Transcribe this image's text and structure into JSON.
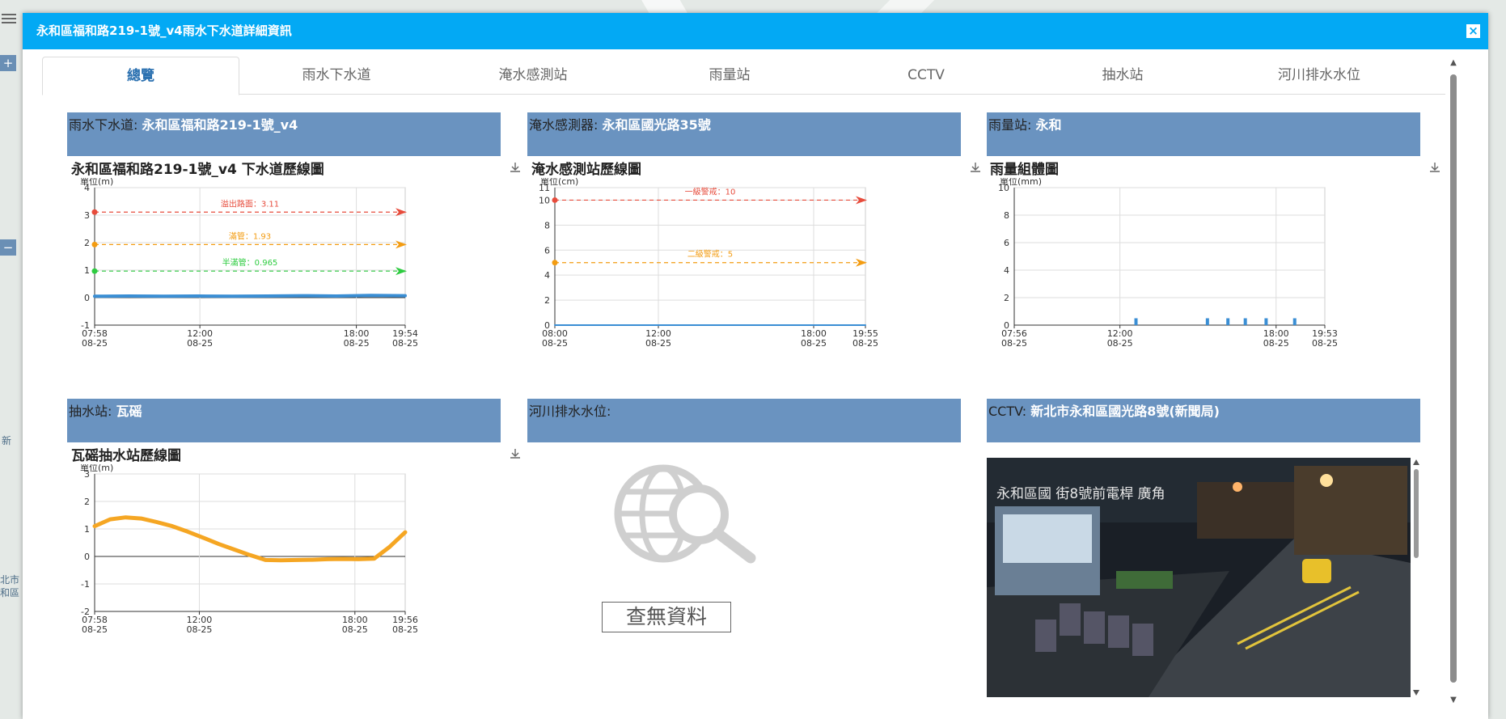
{
  "modal": {
    "title": "永和區福和路219-1號_v4雨水下水道詳細資訊",
    "close_icon": "close-icon"
  },
  "tabs": [
    "總覽",
    "雨水下水道",
    "淹水感測站",
    "雨量站",
    "CCTV",
    "抽水站",
    "河川排水水位"
  ],
  "active_tab": "總覽",
  "cards": {
    "sewer": {
      "label": "雨水下水道: ",
      "value": "永和區福和路219-1號_v4"
    },
    "flood": {
      "label": "淹水感測器: ",
      "value": "永和區國光路35號"
    },
    "rain": {
      "label": "雨量站: ",
      "value": "永和"
    },
    "pump": {
      "label": "抽水站: ",
      "value": "瓦磘"
    },
    "river": {
      "label": "河川排水水位:",
      "value": ""
    },
    "cctv": {
      "label": "CCTV: ",
      "value": "新北市永和區國光路8號(新聞局)"
    }
  },
  "river_nodata": "查無資料",
  "cctv_overlay": "永和區國  街8號前電桿 廣角",
  "chart_data": [
    {
      "id": "sewer",
      "type": "line",
      "title": "永和區福和路219-1號_v4 下水道歷線圖",
      "ylabel": "單位(m)",
      "ylim": [
        -1,
        4
      ],
      "yticks": [
        -1,
        0,
        1,
        2,
        3,
        4
      ],
      "xticks": [
        {
          "l1": "07:58",
          "l2": "08-25",
          "pos": 0
        },
        {
          "l1": "12:00",
          "l2": "08-25",
          "pos": 0.3389
        },
        {
          "l1": "18:00",
          "l2": "08-25",
          "pos": 0.8427
        },
        {
          "l1": "19:54",
          "l2": "08-25",
          "pos": 1
        }
      ],
      "lines": [
        {
          "name": "溢出路面",
          "value": 3.11,
          "label": "溢出路面：3.11",
          "color": "#e74c3c"
        },
        {
          "name": "滿管",
          "value": 1.93,
          "label": "滿管：1.93",
          "color": "#f39c12"
        },
        {
          "name": "半滿管",
          "value": 0.965,
          "label": "半滿管：0.965",
          "color": "#2ecc40"
        }
      ],
      "series": [
        {
          "values": [
            0.05,
            0.06,
            0.05,
            0.06,
            0.05,
            0.06,
            0.07,
            0.06,
            0.08,
            0.07
          ],
          "color": "#3a8ed4",
          "width": 4
        }
      ]
    },
    {
      "id": "flood",
      "type": "line",
      "title": "淹水感測站歷線圖",
      "ylabel": "單位(cm)",
      "ylim": [
        0,
        11
      ],
      "yticks": [
        0,
        2,
        4,
        6,
        8,
        10,
        11
      ],
      "xticks": [
        {
          "l1": "08:00",
          "l2": "08-25",
          "pos": 0
        },
        {
          "l1": "12:00",
          "l2": "08-25",
          "pos": 0.3333
        },
        {
          "l1": "18:00",
          "l2": "08-25",
          "pos": 0.8333
        },
        {
          "l1": "19:55",
          "l2": "08-25",
          "pos": 1
        }
      ],
      "lines": [
        {
          "name": "一級警戒",
          "value": 10,
          "label": "一級警戒：10",
          "color": "#e74c3c"
        },
        {
          "name": "二級警戒",
          "value": 5,
          "label": "二級警戒：5",
          "color": "#f39c12"
        }
      ],
      "series": [
        {
          "values": [
            0,
            0,
            0,
            0,
            0,
            0,
            0,
            0,
            0,
            0
          ],
          "color": "#3a8ed4",
          "width": 2
        }
      ]
    },
    {
      "id": "rain",
      "type": "bar",
      "title": "雨量組體圖",
      "ylabel": "單位(mm)",
      "ylim": [
        0,
        10
      ],
      "yticks": [
        0,
        2,
        4,
        6,
        8,
        10
      ],
      "xticks": [
        {
          "l1": "07:56",
          "l2": "08-25",
          "pos": 0
        },
        {
          "l1": "12:00",
          "l2": "08-25",
          "pos": 0.3403
        },
        {
          "l1": "18:00",
          "l2": "08-25",
          "pos": 0.8431
        },
        {
          "l1": "19:53",
          "l2": "08-25",
          "pos": 1
        }
      ],
      "bars": [
        {
          "pos": 0.392,
          "value": 0.5
        },
        {
          "pos": 0.622,
          "value": 0.5
        },
        {
          "pos": 0.688,
          "value": 0.5
        },
        {
          "pos": 0.744,
          "value": 0.5
        },
        {
          "pos": 0.811,
          "value": 0.5
        },
        {
          "pos": 0.903,
          "value": 0.5
        }
      ]
    },
    {
      "id": "pump",
      "type": "line",
      "title": "瓦磘抽水站歷線圖",
      "ylabel": "單位(m)",
      "ylim": [
        -2,
        3
      ],
      "yticks": [
        -2,
        -1,
        0,
        1,
        2,
        3
      ],
      "xticks": [
        {
          "l1": "07:58",
          "l2": "08-25",
          "pos": 0
        },
        {
          "l1": "12:00",
          "l2": "08-25",
          "pos": 0.3371
        },
        {
          "l1": "18:00",
          "l2": "08-25",
          "pos": 0.838
        },
        {
          "l1": "19:56",
          "l2": "08-25",
          "pos": 1
        }
      ],
      "lines": [],
      "series": [
        {
          "values": [
            1.1,
            1.35,
            1.42,
            1.38,
            1.25,
            1.1,
            0.9,
            0.68,
            0.45,
            0.25,
            0.05,
            -0.13,
            -0.14,
            -0.13,
            -0.12,
            -0.1,
            -0.09,
            -0.1,
            -0.08,
            0.35,
            0.88
          ],
          "color": "#f5a623",
          "width": 5
        }
      ]
    }
  ],
  "map_labels": [
    "新",
    "北市",
    "和區"
  ],
  "colors": {
    "header": "#03a9f4",
    "card_head": "#6a93c0",
    "tab_active": "#2a70b0"
  }
}
